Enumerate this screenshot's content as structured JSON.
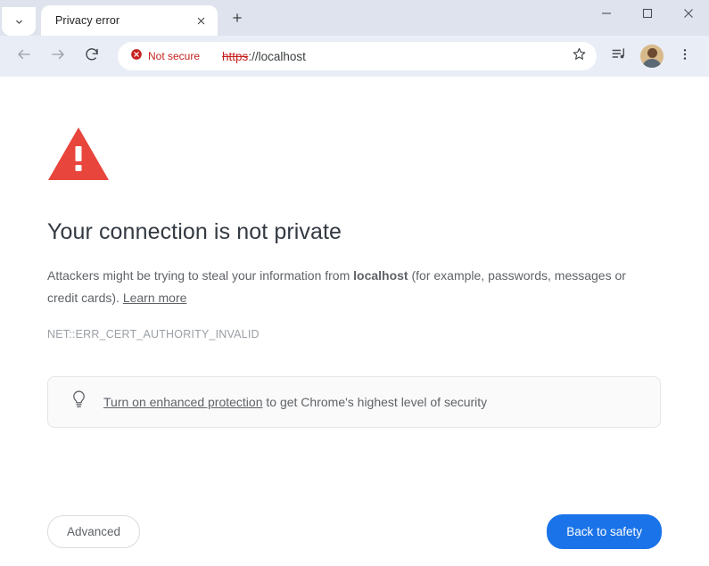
{
  "window": {
    "controls": {
      "minimize": "minimize",
      "maximize": "maximize",
      "close": "close"
    }
  },
  "tabstrip": {
    "tab_search_icon": "chevron-down-icon",
    "new_tab_label": "+",
    "tabs": [
      {
        "title": "Privacy error",
        "close_label": "×",
        "active": true
      }
    ]
  },
  "toolbar": {
    "back_icon": "back-arrow-icon",
    "forward_icon": "forward-arrow-icon",
    "reload_icon": "reload-icon",
    "security": {
      "icon": "not-secure-icon",
      "label": "Not secure",
      "color": "#c5221f"
    },
    "url": {
      "scheme": "https",
      "rest": "://localhost",
      "full": "https://localhost"
    },
    "bookmark_icon": "star-icon",
    "media_icon": "media-control-icon",
    "avatar_icon": "avatar",
    "menu_icon": "three-dot-menu-icon"
  },
  "page": {
    "warning_icon": "warning-triangle-icon",
    "warning_color": "#e8453c",
    "title": "Your connection is not private",
    "body": {
      "part1": "Attackers might be trying to steal your information from ",
      "host": "localhost",
      "part2": " (for example, passwords, messages or credit cards). ",
      "learn_more": "Learn more"
    },
    "error_code": "NET::ERR_CERT_AUTHORITY_INVALID",
    "protection": {
      "icon": "lightbulb-icon",
      "link": "Turn on enhanced protection",
      "text": " to get Chrome's highest level of security"
    },
    "buttons": {
      "advanced": "Advanced",
      "back_to_safety": "Back to safety",
      "primary_color": "#1a73e8"
    }
  }
}
